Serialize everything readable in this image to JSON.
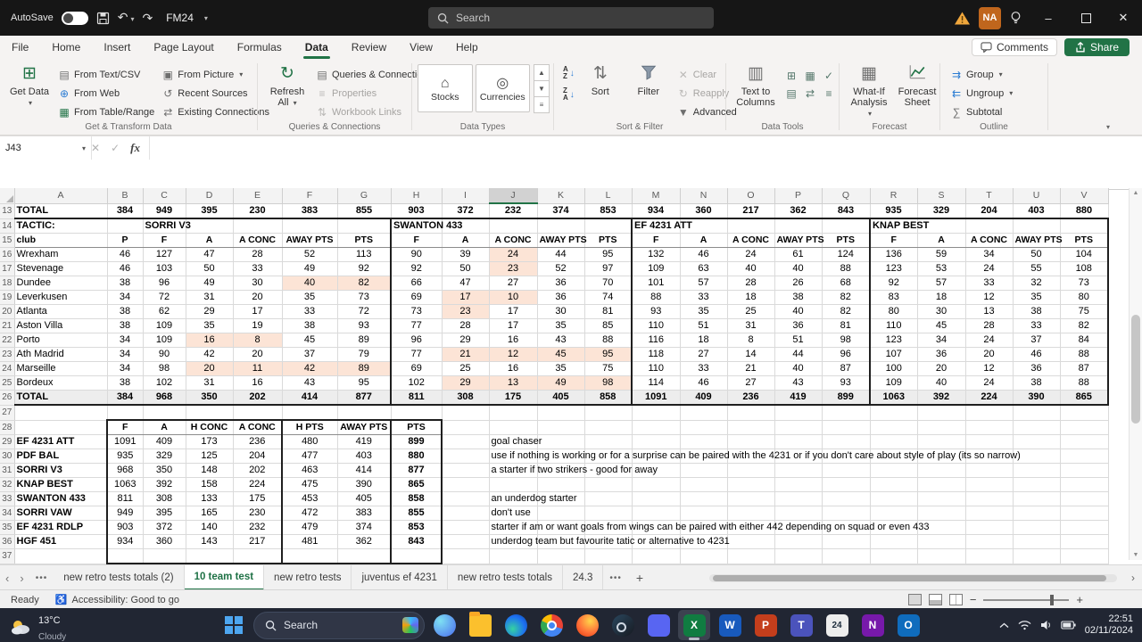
{
  "titlebar": {
    "autosave": "AutoSave",
    "doc_title": "FM24",
    "search_placeholder": "Search",
    "avatar_initials": "NA"
  },
  "ribbon": {
    "tabs": [
      {
        "label": "File"
      },
      {
        "label": "Home"
      },
      {
        "label": "Insert"
      },
      {
        "label": "Page Layout"
      },
      {
        "label": "Formulas"
      },
      {
        "label": "Data",
        "active": true
      },
      {
        "label": "Review"
      },
      {
        "label": "View"
      },
      {
        "label": "Help"
      }
    ],
    "comments": "Comments",
    "share": "Share",
    "get_transform": {
      "label": "Get & Transform Data",
      "get_data": "Get Data",
      "from_text_csv": "From Text/CSV",
      "from_web": "From Web",
      "from_table_range": "From Table/Range",
      "from_picture": "From Picture",
      "recent_sources": "Recent Sources",
      "existing_connections": "Existing Connections"
    },
    "queries": {
      "label": "Queries & Connections",
      "refresh_all": "Refresh All",
      "queries_connections": "Queries & Connections",
      "properties": "Properties",
      "workbook_links": "Workbook Links"
    },
    "data_types": {
      "label": "Data Types",
      "stocks": "Stocks",
      "currencies": "Currencies"
    },
    "sort_filter": {
      "label": "Sort & Filter",
      "sort": "Sort",
      "filter": "Filter",
      "clear": "Clear",
      "reapply": "Reapply",
      "advanced": "Advanced"
    },
    "data_tools": {
      "label": "Data Tools",
      "text_to_columns": "Text to Columns"
    },
    "forecast": {
      "label": "Forecast",
      "what_if": "What-If Analysis",
      "forecast_sheet": "Forecast Sheet"
    },
    "outline": {
      "label": "Outline",
      "group": "Group",
      "ungroup": "Ungroup",
      "subtotal": "Subtotal"
    }
  },
  "formula_bar": {
    "name_box": "J43",
    "fx": "fx"
  },
  "grid": {
    "columns": [
      "A",
      "B",
      "C",
      "D",
      "E",
      "F",
      "G",
      "H",
      "I",
      "J",
      "K",
      "L",
      "M",
      "N",
      "O",
      "P",
      "Q",
      "R",
      "S",
      "T",
      "U",
      "V"
    ],
    "selected_column": "J",
    "bold_rows": [
      13,
      14,
      15,
      26,
      28
    ],
    "gray_rows": [
      26
    ],
    "summary_rows": [
      29,
      30,
      31,
      32,
      33,
      34,
      35,
      36
    ],
    "note_rows": [
      29,
      30,
      31,
      33,
      34,
      35,
      36
    ],
    "left_align_rows": [
      14
    ],
    "header_font_rows": [
      15,
      28
    ],
    "peach_cells": [
      "J16",
      "J17",
      "F18",
      "G18",
      "I19",
      "J19",
      "I20",
      "D22",
      "E22",
      "I23",
      "J23",
      "K23",
      "L23",
      "D24",
      "E24",
      "F24",
      "G24",
      "I25",
      "J25",
      "K25",
      "L25"
    ],
    "rows": [
      {
        "n": 13,
        "cells": [
          "TOTAL",
          "384",
          "949",
          "395",
          "230",
          "383",
          "855",
          "903",
          "372",
          "232",
          "374",
          "853",
          "934",
          "360",
          "217",
          "362",
          "843",
          "935",
          "329",
          "204",
          "403",
          "880"
        ]
      },
      {
        "n": 14,
        "cells": [
          "TACTIC:",
          "",
          "SORRI V3",
          "",
          "",
          "",
          "",
          "SWANTON 433",
          "",
          "",
          "",
          "",
          "EF 4231 ATT",
          "",
          "",
          "",
          "",
          "KNAP BEST",
          "",
          "",
          "",
          ""
        ]
      },
      {
        "n": 15,
        "cells": [
          "club",
          "P",
          "F",
          "A",
          "A CONC",
          "AWAY PTS",
          "PTS",
          "F",
          "A",
          "A CONC",
          "AWAY PTS",
          "PTS",
          "F",
          "A",
          "A CONC",
          "AWAY PTS",
          "PTS",
          "F",
          "A",
          "A CONC",
          "AWAY PTS",
          "PTS"
        ]
      },
      {
        "n": 16,
        "cells": [
          "Wrexham",
          "46",
          "127",
          "47",
          "28",
          "52",
          "113",
          "90",
          "39",
          "24",
          "44",
          "95",
          "132",
          "46",
          "24",
          "61",
          "124",
          "136",
          "59",
          "34",
          "50",
          "104"
        ]
      },
      {
        "n": 17,
        "cells": [
          "Stevenage",
          "46",
          "103",
          "50",
          "33",
          "49",
          "92",
          "92",
          "50",
          "23",
          "52",
          "97",
          "109",
          "63",
          "40",
          "40",
          "88",
          "123",
          "53",
          "24",
          "55",
          "108"
        ]
      },
      {
        "n": 18,
        "cells": [
          "Dundee",
          "38",
          "96",
          "49",
          "30",
          "40",
          "82",
          "66",
          "47",
          "27",
          "36",
          "70",
          "101",
          "57",
          "28",
          "26",
          "68",
          "92",
          "57",
          "33",
          "32",
          "73"
        ]
      },
      {
        "n": 19,
        "cells": [
          "Leverkusen",
          "34",
          "72",
          "31",
          "20",
          "35",
          "73",
          "69",
          "17",
          "10",
          "36",
          "74",
          "88",
          "33",
          "18",
          "38",
          "82",
          "83",
          "18",
          "12",
          "35",
          "80"
        ]
      },
      {
        "n": 20,
        "cells": [
          "Atlanta",
          "38",
          "62",
          "29",
          "17",
          "33",
          "72",
          "73",
          "23",
          "17",
          "30",
          "81",
          "93",
          "35",
          "25",
          "40",
          "82",
          "80",
          "30",
          "13",
          "38",
          "75"
        ]
      },
      {
        "n": 21,
        "cells": [
          "Aston Villa",
          "38",
          "109",
          "35",
          "19",
          "38",
          "93",
          "77",
          "28",
          "17",
          "35",
          "85",
          "110",
          "51",
          "31",
          "36",
          "81",
          "110",
          "45",
          "28",
          "33",
          "82"
        ]
      },
      {
        "n": 22,
        "cells": [
          "Porto",
          "34",
          "109",
          "16",
          "8",
          "45",
          "89",
          "96",
          "29",
          "16",
          "43",
          "88",
          "116",
          "18",
          "8",
          "51",
          "98",
          "123",
          "34",
          "24",
          "37",
          "84"
        ]
      },
      {
        "n": 23,
        "cells": [
          "Ath Madrid",
          "34",
          "90",
          "42",
          "20",
          "37",
          "79",
          "77",
          "21",
          "12",
          "45",
          "95",
          "118",
          "27",
          "14",
          "44",
          "96",
          "107",
          "36",
          "20",
          "46",
          "88"
        ]
      },
      {
        "n": 24,
        "cells": [
          "Marseille",
          "34",
          "98",
          "20",
          "11",
          "42",
          "89",
          "69",
          "25",
          "16",
          "35",
          "75",
          "110",
          "33",
          "21",
          "40",
          "87",
          "100",
          "20",
          "12",
          "36",
          "87"
        ]
      },
      {
        "n": 25,
        "cells": [
          "Bordeux",
          "38",
          "102",
          "31",
          "16",
          "43",
          "95",
          "102",
          "29",
          "13",
          "49",
          "98",
          "114",
          "46",
          "27",
          "43",
          "93",
          "109",
          "40",
          "24",
          "38",
          "88"
        ]
      },
      {
        "n": 26,
        "cells": [
          "TOTAL",
          "384",
          "968",
          "350",
          "202",
          "414",
          "877",
          "811",
          "308",
          "175",
          "405",
          "858",
          "1091",
          "409",
          "236",
          "419",
          "899",
          "1063",
          "392",
          "224",
          "390",
          "865"
        ]
      },
      {
        "n": 27,
        "cells": [
          "",
          "",
          "",
          "",
          "",
          "",
          "",
          "",
          "",
          "",
          "",
          "",
          "",
          "",
          "",
          "",
          "",
          "",
          "",
          "",
          "",
          ""
        ]
      },
      {
        "n": 28,
        "cells": [
          "",
          "F",
          "A",
          "H CONC",
          "A CONC",
          "H PTS",
          "AWAY PTS",
          "PTS",
          "",
          "",
          "",
          "",
          "",
          "",
          "",
          "",
          "",
          "",
          "",
          "",
          "",
          ""
        ]
      },
      {
        "n": 29,
        "cells": [
          "EF 4231 ATT",
          "1091",
          "409",
          "173",
          "236",
          "480",
          "419",
          "899",
          "",
          "goal chaser",
          "",
          "",
          "",
          "",
          "",
          "",
          "",
          "",
          "",
          "",
          "",
          ""
        ]
      },
      {
        "n": 30,
        "cells": [
          "PDF BAL",
          "935",
          "329",
          "125",
          "204",
          "477",
          "403",
          "880",
          "",
          "use if nothing is working or for a surprise can be paired with the 4231 or if you don't care about style of play (its so narrow)",
          "",
          "",
          "",
          "",
          "",
          "",
          "",
          "",
          "",
          "",
          "",
          ""
        ]
      },
      {
        "n": 31,
        "cells": [
          "SORRI V3",
          "968",
          "350",
          "148",
          "202",
          "463",
          "414",
          "877",
          "",
          "a starter if two strikers - good for away",
          "",
          "",
          "",
          "",
          "",
          "",
          "",
          "",
          "",
          "",
          "",
          ""
        ]
      },
      {
        "n": 32,
        "cells": [
          "KNAP BEST",
          "1063",
          "392",
          "158",
          "224",
          "475",
          "390",
          "865",
          "",
          "",
          "",
          "",
          "",
          "",
          "",
          "",
          "",
          "",
          "",
          "",
          "",
          ""
        ]
      },
      {
        "n": 33,
        "cells": [
          "SWANTON 433",
          "811",
          "308",
          "133",
          "175",
          "453",
          "405",
          "858",
          "",
          "an underdog starter",
          "",
          "",
          "",
          "",
          "",
          "",
          "",
          "",
          "",
          "",
          "",
          ""
        ]
      },
      {
        "n": 34,
        "cells": [
          "SORRI VAW",
          "949",
          "395",
          "165",
          "230",
          "472",
          "383",
          "855",
          "",
          "don't use",
          "",
          "",
          "",
          "",
          "",
          "",
          "",
          "",
          "",
          "",
          "",
          ""
        ]
      },
      {
        "n": 35,
        "cells": [
          "EF 4231 RDLP",
          "903",
          "372",
          "140",
          "232",
          "479",
          "374",
          "853",
          "",
          "starter if am or want goals from wings can be paired with either 442 depending on squad or even 433",
          "",
          "",
          "",
          "",
          "",
          "",
          "",
          "",
          "",
          "",
          "",
          ""
        ]
      },
      {
        "n": 36,
        "cells": [
          "HGF 451",
          "934",
          "360",
          "143",
          "217",
          "481",
          "362",
          "843",
          "",
          "underdog team but favourite tatic or alternative to 4231",
          "",
          "",
          "",
          "",
          "",
          "",
          "",
          "",
          "",
          "",
          "",
          ""
        ]
      },
      {
        "n": 37,
        "cells": [
          "",
          "",
          "",
          "",
          "",
          "",
          "",
          "",
          "",
          "",
          "",
          "",
          "",
          "",
          "",
          "",
          "",
          "",
          "",
          "",
          "",
          ""
        ]
      }
    ]
  },
  "sheet_bar": {
    "tabs": [
      {
        "label": "new retro tests totals (2)"
      },
      {
        "label": "10 team test",
        "active": true
      },
      {
        "label": "new retro tests"
      },
      {
        "label": "juventus ef 4231"
      },
      {
        "label": "new retro tests totals"
      },
      {
        "label": "24.3"
      }
    ]
  },
  "status_bar": {
    "mode": "Ready",
    "accessibility": "Accessibility: Good to go"
  },
  "taskbar": {
    "weather_temp": "13°C",
    "weather_desc": "Cloudy",
    "search": "Search",
    "time": "22:51",
    "date": "02/11/2024",
    "apps": [
      {
        "name": "copilot"
      },
      {
        "name": "file-explorer"
      },
      {
        "name": "edge"
      },
      {
        "name": "chrome"
      },
      {
        "name": "firefox"
      },
      {
        "name": "steam"
      },
      {
        "name": "discord"
      },
      {
        "name": "excel",
        "active": true,
        "glyph": "X",
        "color": "#107c41",
        "glyph_color": "#ffffff"
      },
      {
        "name": "word",
        "glyph": "W",
        "color": "#185abd",
        "glyph_color": "#ffffff"
      },
      {
        "name": "powerpoint",
        "glyph": "P",
        "color": "#c43e1c",
        "glyph_color": "#ffffff"
      },
      {
        "name": "teams",
        "glyph": "T",
        "color": "#4b53bc",
        "glyph_color": "#ffffff"
      },
      {
        "name": "fm24",
        "glyph": "24",
        "color": "#ededed",
        "glyph_color": "#1c2c3c"
      },
      {
        "name": "onenote",
        "glyph": "N",
        "color": "#7719aa",
        "glyph_color": "#ffffff"
      },
      {
        "name": "outlook",
        "glyph": "O",
        "color": "#0f6cbd",
        "glyph_color": "#ffffff"
      }
    ]
  },
  "icons": {
    "get_data": "⊞",
    "text_file": "▤",
    "globe": "⊕",
    "table": "▦",
    "picture": "▣",
    "recent": "↺",
    "connections": "⇄",
    "refresh": "↻",
    "queries": "▤",
    "properties": "≡",
    "workbook_links": "⇅",
    "bank": "⌂",
    "coins": "◎",
    "sort": "⇅",
    "clear": "✕",
    "reapply": "↻",
    "advanced": "▼",
    "text_to_columns": "▥",
    "dt1": "⊞",
    "dt2": "▦",
    "dt3": "✓",
    "dt4": "▤",
    "dt5": "⇄",
    "dt6": "≡",
    "what_if": "▦",
    "group": "⇉",
    "ungroup": "⇇",
    "subtotal": "∑",
    "undo": "↶",
    "redo": "↷",
    "dropdown": "▾",
    "gallery_up": "▲",
    "gallery_down": "▼",
    "gallery_more": "≡",
    "nav_left": "‹",
    "nav_right": "›",
    "tab_overflow": "•••",
    "add_sheet": "+",
    "collapse_ribbon": "∨",
    "cancel": "✕",
    "enter": "✓",
    "zoom_out": "−",
    "zoom_in": "+",
    "accessibility": "♿",
    "minimize": "–",
    "close": "✕",
    "sort_arrow_down": "↓",
    "az_a": "A",
    "az_z": "Z"
  }
}
